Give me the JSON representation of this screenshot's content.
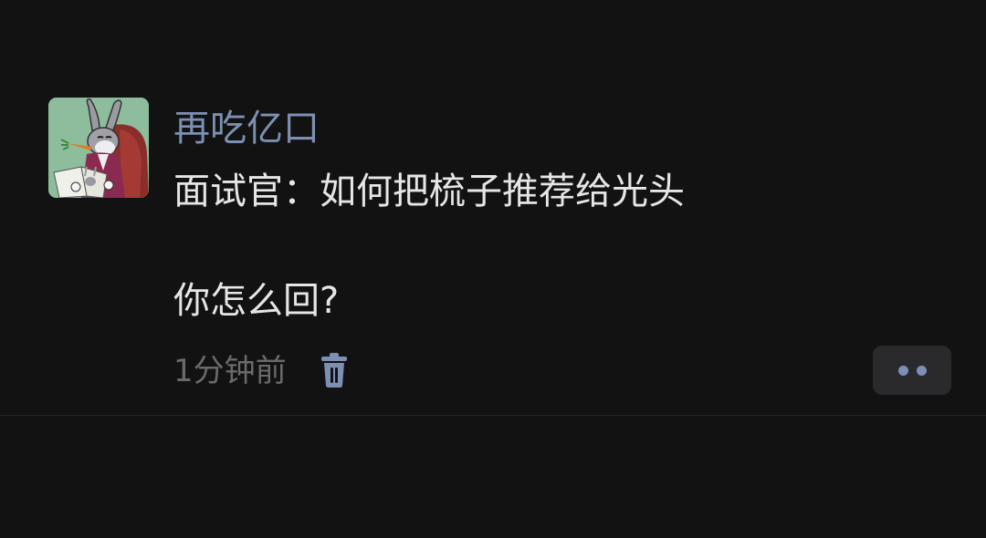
{
  "post": {
    "username": "再吃亿口",
    "content": {
      "line1": "面试官：如何把梳子推荐给光头",
      "line2": "你怎么回?"
    },
    "timestamp": "1分钟前"
  },
  "icons": {
    "avatar": "cartoon-rabbit-reading-avatar",
    "delete": "trash-icon",
    "more": "more-dots-icon"
  },
  "colors": {
    "background": "#121212",
    "username": "#7d90b3",
    "content_text": "#e6e6e6",
    "timestamp": "#6a6a6a",
    "more_button_bg": "#2a2a2c"
  }
}
